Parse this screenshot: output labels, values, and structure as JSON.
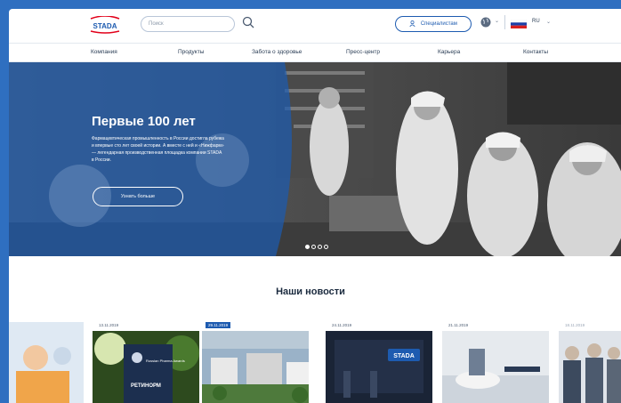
{
  "header": {
    "logo_text": "STADA",
    "search": {
      "placeholder": "Поиск"
    },
    "specialists_button": "Специалистам",
    "language": "RU"
  },
  "nav": {
    "items": [
      "Компания",
      "Продукты",
      "Забота о здоровье",
      "Пресс-центр",
      "Карьера",
      "Контакты"
    ]
  },
  "hero": {
    "title": "Первые 100 лет",
    "text": "Фармацевтическая промышленность в России достигла рубежа и впервые сто лет своей истории. А вместе с ней и «Нижфарм» — легендарная производственная площадка компании STADA в России.",
    "button": "Узнать больше",
    "slides_count": 4,
    "active_slide": 1
  },
  "news": {
    "title": "Наши новости",
    "cards": [
      {
        "date": ""
      },
      {
        "date": "13.11.2019",
        "caption": "Russian Pharma Awards",
        "sub": "РЕТИНОРМ"
      },
      {
        "date": "29.11.2019",
        "highlighted": true
      },
      {
        "date": "24.11.2019",
        "logo": "STADA"
      },
      {
        "date": "21.11.2019"
      },
      {
        "date": "18.11.2019"
      }
    ]
  },
  "colors": {
    "brand_blue": "#1d5bb0",
    "accent_red": "#e2001a"
  }
}
